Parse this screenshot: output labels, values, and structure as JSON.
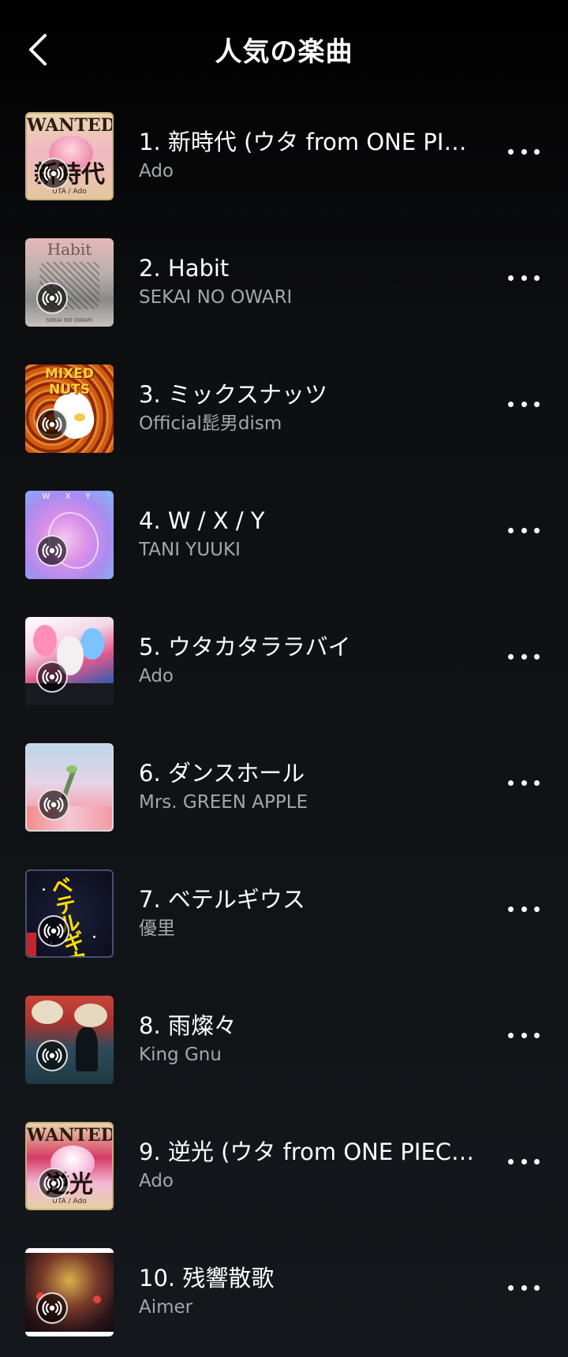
{
  "header": {
    "title": "人気の楽曲"
  },
  "tracks": [
    {
      "title": "1. 新時代 (ウタ from ONE PIE…",
      "artist": "Ado",
      "art_text": "WANTED",
      "art_big": "新時代",
      "art_sub": "UTA / Ado"
    },
    {
      "title": "2. Habit",
      "artist": "SEKAI NO OWARI",
      "art_text": "Habit",
      "art_big": "",
      "art_sub": "SEKAI NO OWARI"
    },
    {
      "title": "3. ミックスナッツ",
      "artist": "Official髭男dism",
      "art_text": "MIXED NUTS",
      "art_big": "",
      "art_sub": ""
    },
    {
      "title": "4. W / X / Y",
      "artist": "TANI YUUKI",
      "art_text": "W X Y",
      "art_big": "",
      "art_sub": ""
    },
    {
      "title": "5. ウタカタララバイ",
      "artist": "Ado",
      "art_text": "",
      "art_big": "",
      "art_sub": ""
    },
    {
      "title": "6. ダンスホール",
      "artist": "Mrs. GREEN APPLE",
      "art_text": "",
      "art_big": "",
      "art_sub": ""
    },
    {
      "title": "7. ベテルギウス",
      "artist": "優里",
      "art_text": "ベテルギウス",
      "art_big": "",
      "art_sub": ""
    },
    {
      "title": "8. 雨燦々",
      "artist": "King Gnu",
      "art_text": "",
      "art_big": "",
      "art_sub": ""
    },
    {
      "title": "9. 逆光 (ウタ from ONE PIEC…",
      "artist": "Ado",
      "art_text": "WANTED",
      "art_big": "逆光",
      "art_sub": "UTA / Ado"
    },
    {
      "title": "10. 残響散歌",
      "artist": "Aimer",
      "art_text": "",
      "art_big": "",
      "art_sub": ""
    }
  ],
  "icons": {
    "back": "chevron-left-icon",
    "live": "broadcast-icon",
    "more": "more-horizontal-icon"
  },
  "colors": {
    "background": "#0d0e10",
    "artist_text": "#a4a8ad"
  }
}
